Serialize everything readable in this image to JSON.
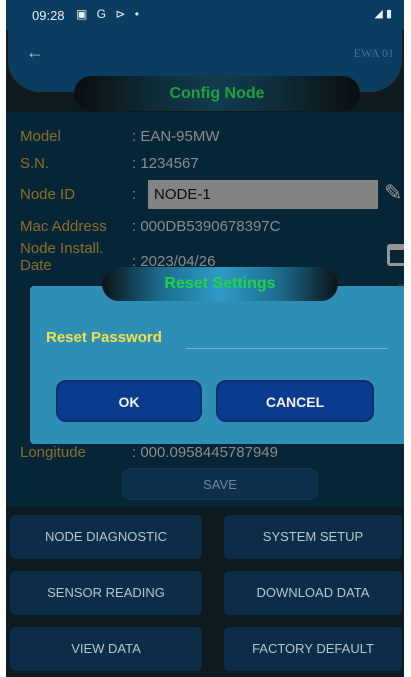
{
  "status_bar": {
    "time": "09:28",
    "notification_icons": "▣ G ⊳ •",
    "right_icons": "◢ ▮"
  },
  "header": {
    "back_icon": "←",
    "device_id": "EWA 01"
  },
  "title": "Config Node",
  "form": {
    "model_label": "Model",
    "model_value": ": EAN-95MW",
    "sn_label": "S.N.",
    "sn_value": ": 1234567",
    "nodeid_label": "Node ID",
    "nodeid_colon": ":",
    "nodeid_value": "NODE-1",
    "mac_label": "Mac Address",
    "mac_value": ": 000DB5390678397C",
    "install_label": "Node Install. Date",
    "install_value": ": 2023/04/26",
    "longitude_label": "Longitude",
    "longitude_value": ": 000.0958445787949"
  },
  "save_label": "SAVE",
  "dialog": {
    "title": "Reset Settings",
    "password_label": "Reset Password",
    "password_value": "",
    "ok_label": "OK",
    "cancel_label": "CANCEL"
  },
  "buttons": {
    "node_diagnostic": "NODE DIAGNOSTIC",
    "system_setup": "SYSTEM SETUP",
    "sensor_reading": "SENSOR READING",
    "download_data": "DOWNLOAD DATA",
    "view_data": "VIEW DATA",
    "factory_default": "FACTORY DEFAULT"
  },
  "colors": {
    "accent_green": "#20d34a",
    "label_gold": "#d6a93d",
    "dialog_bg": "#2f8eb6",
    "button_blue": "#0b3b8e"
  }
}
